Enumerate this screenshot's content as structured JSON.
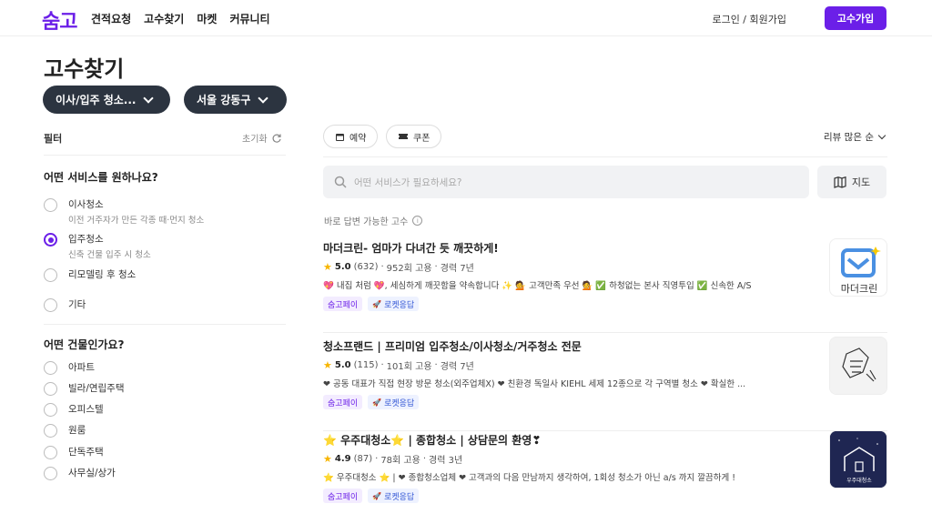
{
  "app": {
    "logo": "숨고"
  },
  "nav": {
    "links": [
      "견적요청",
      "고수찾기",
      "마켓",
      "커뮤니티"
    ],
    "login": "로그인 / 회원가입",
    "pro_signup": "고수가입"
  },
  "page": {
    "title": "고수찾기"
  },
  "selectors": {
    "service": "이사/입주 청소...",
    "region": "서울 강동구"
  },
  "filters": {
    "header": "필터",
    "reset": "초기화",
    "service_question": "어떤 서비스를 원하나요?",
    "service_options": [
      {
        "label": "이사청소",
        "sub": "이전 거주자가 만든 각종 때·먼지 청소",
        "selected": false
      },
      {
        "label": "입주청소",
        "sub": "신축 건물 입주 시 청소",
        "selected": true
      },
      {
        "label": "리모델링 후 청소",
        "sub": "",
        "selected": false
      },
      {
        "label": "기타",
        "sub": "",
        "selected": false
      }
    ],
    "building_question": "어떤 건물인가요?",
    "building_options": [
      "아파트",
      "빌라/연립주택",
      "오피스텔",
      "원룸",
      "단독주택",
      "사무실/상가"
    ]
  },
  "chips": {
    "reservation": "예약",
    "coupon": "쿠폰"
  },
  "sort": {
    "label": "리뷰 많은 순"
  },
  "search": {
    "placeholder": "어떤 서비스가 필요하세요?"
  },
  "map_button": "지도",
  "instant_label": "바로 답변 가능한 고수",
  "cards": [
    {
      "title": "마더크린- 엄마가 다녀간 듯 깨끗하게!",
      "rating": "5.0",
      "reviews": "(632)",
      "hires": "952회 고용",
      "career": "경력 7년",
      "desc": "💖 내집 처럼 💖, 세심하게 깨끗함을 약속합니다 ✨ 💁 고객만족 우선 💁 ✅ 하청없는 본사 직영투입 ✅ 신속한 A/S",
      "tags": [
        "숨고페이",
        "로켓응답"
      ],
      "thumb_text": "마더크린"
    },
    {
      "title": "청소프랜드 | 프리미엄 입주청소/이사청소/거주청소 전문",
      "rating": "5.0",
      "reviews": "(115)",
      "hires": "101회 고용",
      "career": "경력 7년",
      "desc": "❤ 공동 대표가 직접 현장 방문 청소(외주업체X) ❤ 친환경 독일사 KIEHL 세제 12종으로 각 구역별 청소 ❤ 확실한 ...",
      "tags": [
        "숨고페이",
        "로켓응답"
      ],
      "thumb_text": ""
    },
    {
      "title": "⭐ 우주대청소⭐ | 종합청소 | 상담문의 환영❣",
      "rating": "4.9",
      "reviews": "(87)",
      "hires": "78회 고용",
      "career": "경력 3년",
      "desc": "⭐ 우주대청소 ⭐ | ❤ 종합청소업체 ❤ 고객과의 다음 만남까지 생각하여, 1회성 청소가 아닌 a/s 까지 깔끔하게 !",
      "tags": [
        "숨고페이",
        "로켓응답"
      ],
      "thumb_text": "우주대청소"
    }
  ],
  "colors": {
    "brand": "#6b1fe8",
    "pill": "#2c3440",
    "star": "#f7b500"
  }
}
